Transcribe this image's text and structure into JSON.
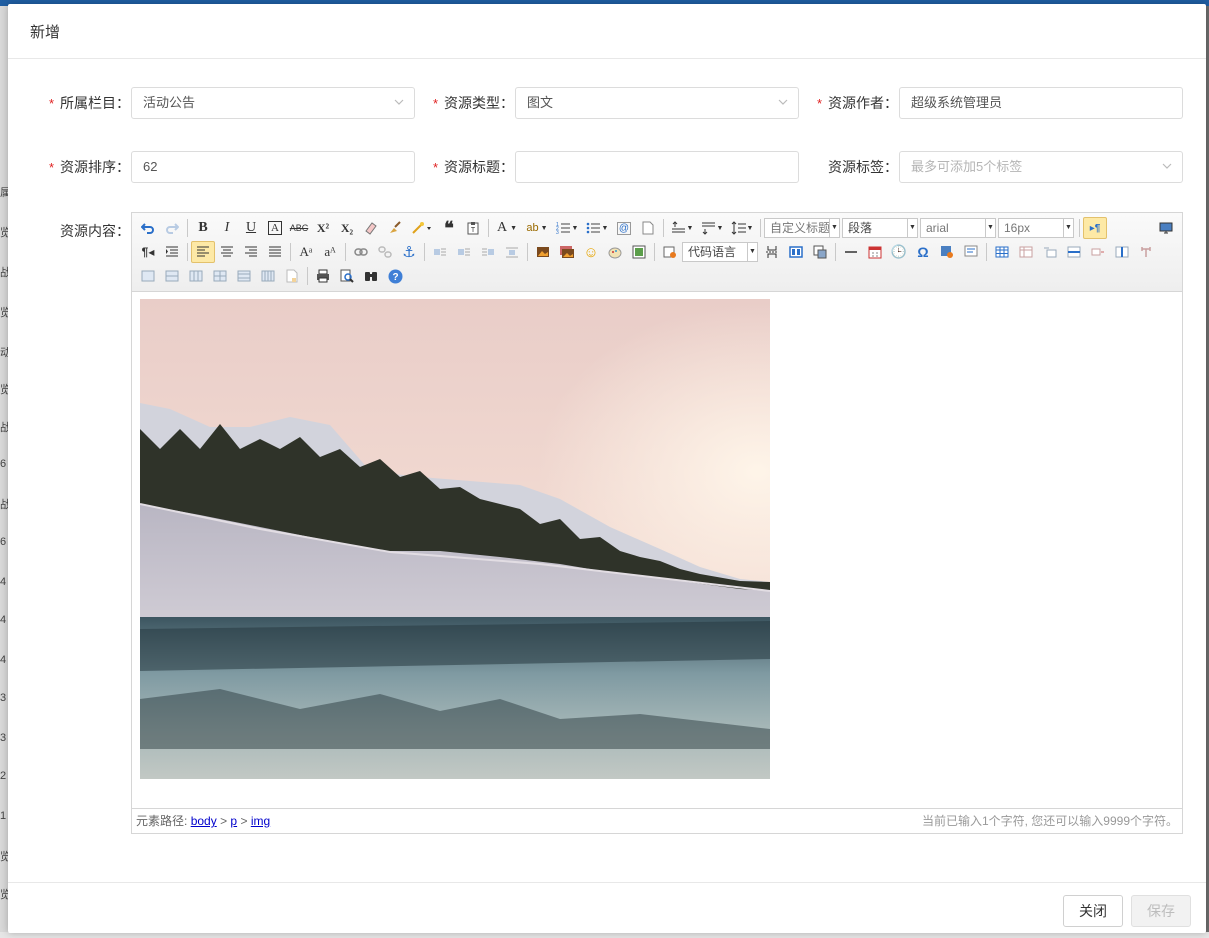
{
  "dialog": {
    "title": "新增"
  },
  "form": {
    "column": {
      "label": "所属栏目：",
      "value": "活动公告"
    },
    "type": {
      "label": "资源类型：",
      "value": "图文"
    },
    "author": {
      "label": "资源作者：",
      "value": "超级系统管理员"
    },
    "sort": {
      "label": "资源排序：",
      "value": "62"
    },
    "title": {
      "label": "资源标题：",
      "value": ""
    },
    "tags": {
      "label": "资源标签：",
      "placeholder": "最多可添加5个标签"
    },
    "content": {
      "label": "资源内容："
    },
    "required_mark": "*"
  },
  "editor": {
    "combos": {
      "custom_title": "自定义标题",
      "paragraph": "段落",
      "font": "arial",
      "size": "16px",
      "code_lang": "代码语言"
    },
    "statusbar": {
      "path_prefix": "元素路径:",
      "path_body": "body",
      "path_p": "p",
      "path_img": "img",
      "sep": ">",
      "count": "当前已输入1个字符, 您还可以输入9999个字符。"
    }
  },
  "footer": {
    "close": "关闭",
    "save": "保存"
  },
  "background_text": [
    "属",
    "览",
    "战",
    "览",
    "动",
    "览",
    "战",
    "6",
    "战",
    "6",
    "4",
    "4",
    "4",
    "3",
    "3",
    "2",
    "1",
    "览",
    "览"
  ],
  "colors": {
    "required": "#e02020",
    "header_bar": "#1f5ea3",
    "link": "#0000cc"
  }
}
